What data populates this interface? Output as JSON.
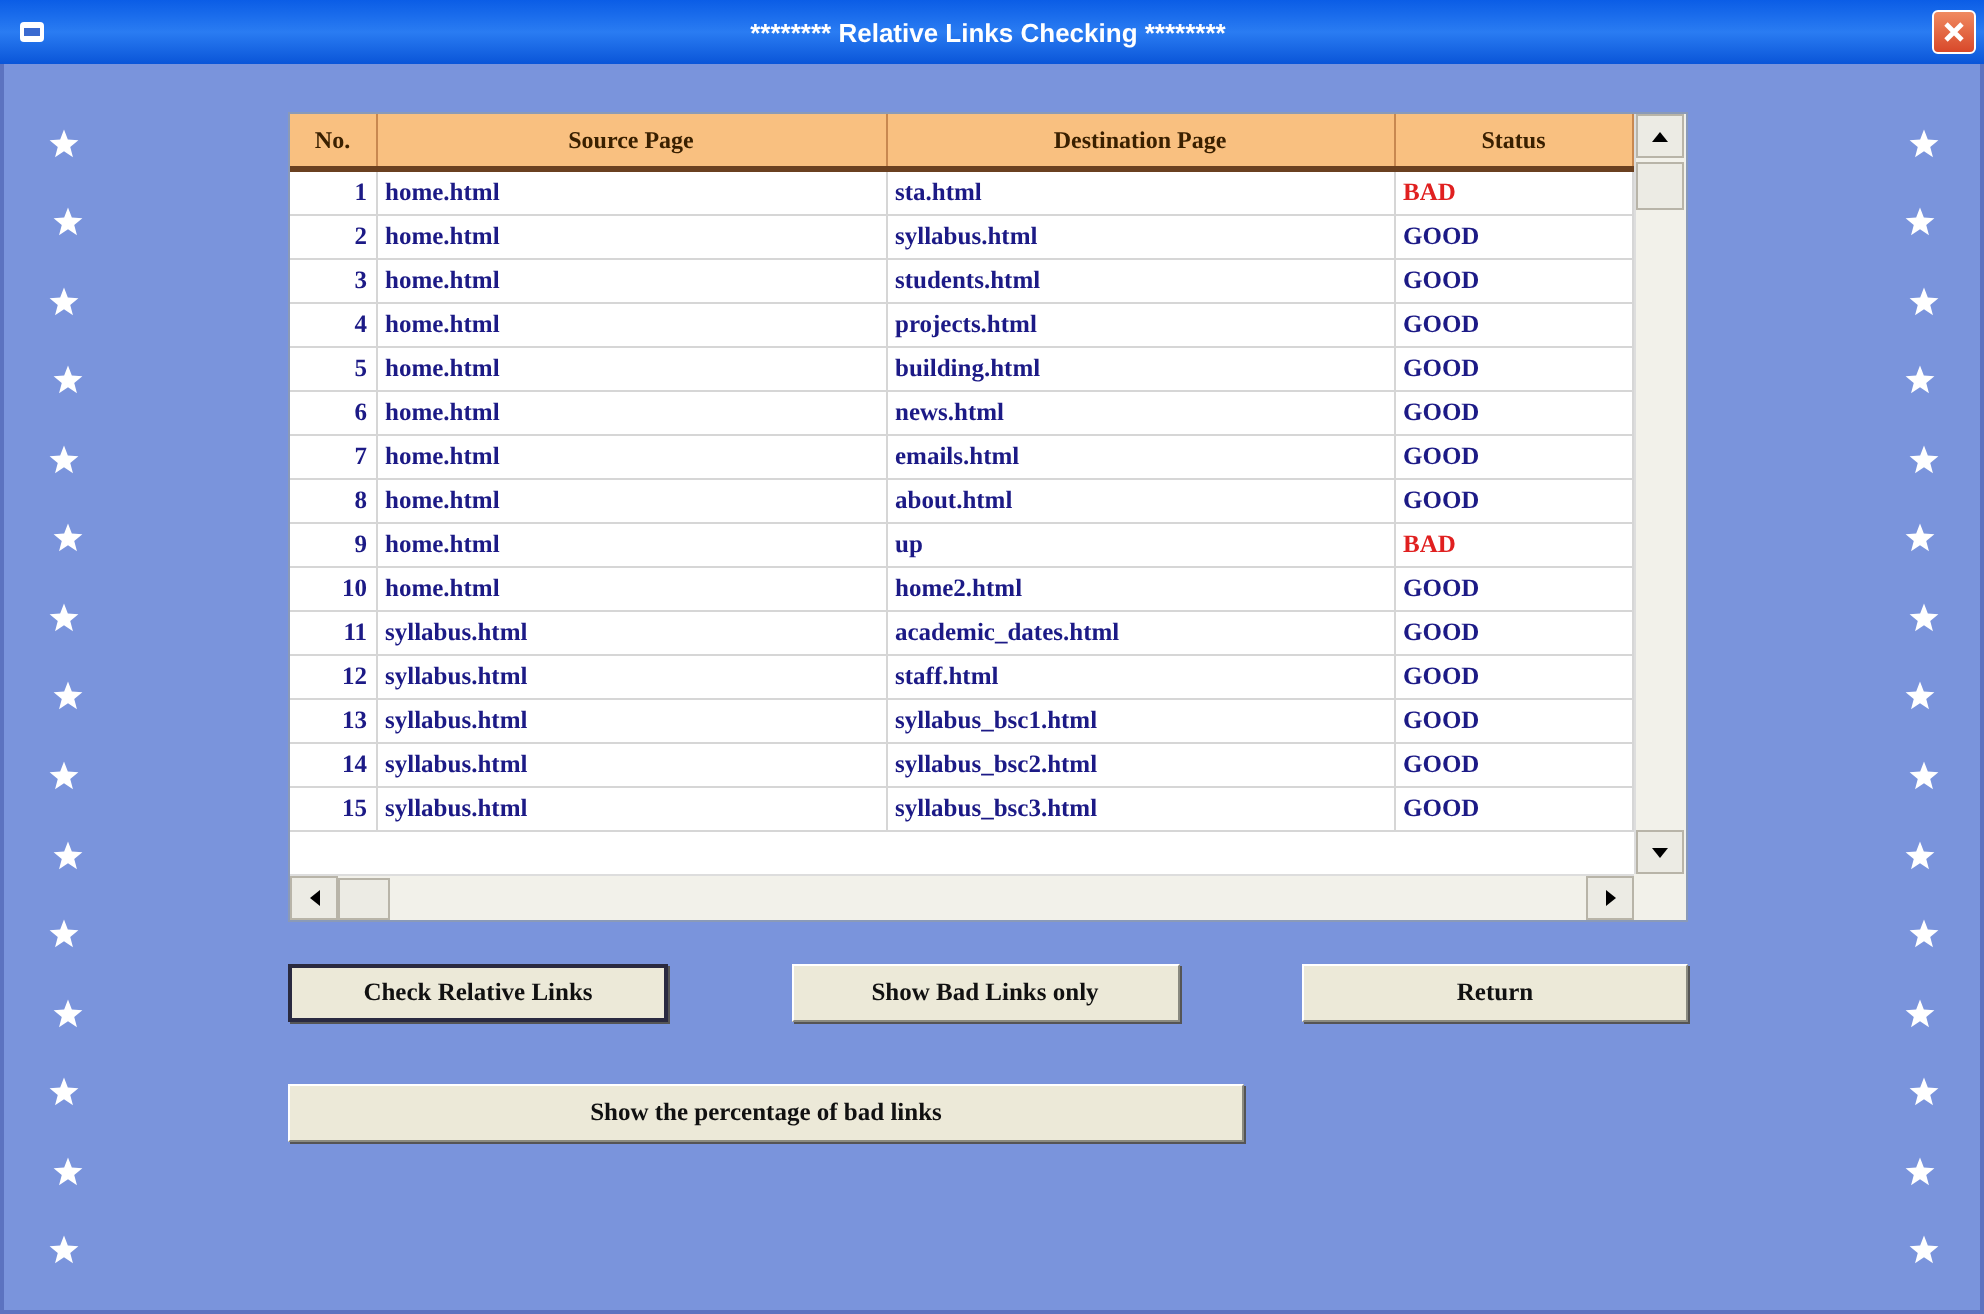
{
  "window": {
    "title": "******** Relative Links Checking ********"
  },
  "table": {
    "columns": [
      "No.",
      "Source Page",
      "Destination Page",
      "Status"
    ],
    "rows": [
      {
        "no": "1",
        "source": "home.html",
        "destination": "sta.html",
        "status": "BAD",
        "kind": "bad"
      },
      {
        "no": "2",
        "source": "home.html",
        "destination": "syllabus.html",
        "status": "GOOD",
        "kind": "good"
      },
      {
        "no": "3",
        "source": "home.html",
        "destination": "students.html",
        "status": "GOOD",
        "kind": "good"
      },
      {
        "no": "4",
        "source": "home.html",
        "destination": "projects.html",
        "status": "GOOD",
        "kind": "good"
      },
      {
        "no": "5",
        "source": "home.html",
        "destination": "building.html",
        "status": "GOOD",
        "kind": "good"
      },
      {
        "no": "6",
        "source": "home.html",
        "destination": "news.html",
        "status": "GOOD",
        "kind": "good"
      },
      {
        "no": "7",
        "source": "home.html",
        "destination": "emails.html",
        "status": "GOOD",
        "kind": "good"
      },
      {
        "no": "8",
        "source": "home.html",
        "destination": "about.html",
        "status": "GOOD",
        "kind": "good"
      },
      {
        "no": "9",
        "source": "home.html",
        "destination": "up",
        "status": "BAD",
        "kind": "bad"
      },
      {
        "no": "10",
        "source": "home.html",
        "destination": "home2.html",
        "status": "GOOD",
        "kind": "good"
      },
      {
        "no": "11",
        "source": "syllabus.html",
        "destination": "academic_dates.html",
        "status": "GOOD",
        "kind": "good"
      },
      {
        "no": "12",
        "source": "syllabus.html",
        "destination": "staff.html",
        "status": "GOOD",
        "kind": "good"
      },
      {
        "no": "13",
        "source": "syllabus.html",
        "destination": "syllabus_bsc1.html",
        "status": "GOOD",
        "kind": "good"
      },
      {
        "no": "14",
        "source": "syllabus.html",
        "destination": "syllabus_bsc2.html",
        "status": "GOOD",
        "kind": "good"
      },
      {
        "no": "15",
        "source": "syllabus.html",
        "destination": "syllabus_bsc3.html",
        "status": "GOOD",
        "kind": "good"
      }
    ]
  },
  "buttons": [
    {
      "label": "Check Relative Links",
      "focused": true
    },
    {
      "label": "Show Bad Links only",
      "focused": false
    },
    {
      "label": "Return",
      "focused": false
    }
  ],
  "percentage_button": {
    "label": "Show the percentage of bad links",
    "focused": false
  }
}
